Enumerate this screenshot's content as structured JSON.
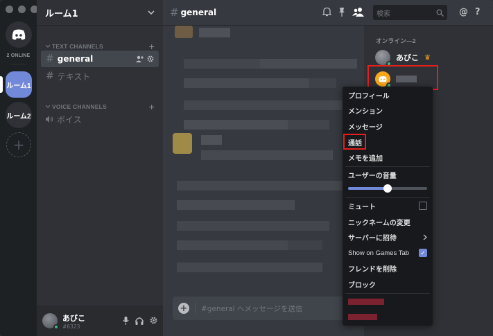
{
  "window": {
    "traffic_lights": [
      "close",
      "minimize",
      "maximize"
    ]
  },
  "guilds": {
    "online_count": "2 ONLINE",
    "servers": [
      {
        "label": "ルーム1",
        "active": true
      },
      {
        "label": "ルーム2",
        "active": false
      }
    ]
  },
  "server": {
    "name": "ルーム1",
    "categories": {
      "text": "TEXT CHANNELS",
      "voice": "VOICE CHANNELS"
    },
    "text_channels": [
      "general",
      "テキスト"
    ],
    "voice_channels": [
      "ボイス"
    ]
  },
  "user": {
    "name": "あびこ",
    "tag": "#6323"
  },
  "chat": {
    "channel_name": "general",
    "search_placeholder": "検索",
    "composer_placeholder": "#general へメッセージを送信"
  },
  "members": {
    "heading": "オンライン—2",
    "list": [
      {
        "name": "あびこ",
        "owner": true
      },
      {
        "name": "",
        "owner": false
      }
    ]
  },
  "context_menu": {
    "items": [
      "プロフィール",
      "メンション",
      "メッセージ",
      "通話",
      "メモを追加"
    ],
    "volume_label": "ユーザーの音量",
    "volume_level": 0.5,
    "mute_label": "ミュート",
    "nickname_label": "ニックネームの変更",
    "invite_label": "サーバーに招待",
    "games_tab_label": "Show on Games Tab",
    "remove_friend_label": "フレンドを削除",
    "block_label": "ブロック"
  },
  "colors": {
    "accent": "#7289da",
    "online": "#43b581",
    "highlight_box": "#e3201b"
  }
}
